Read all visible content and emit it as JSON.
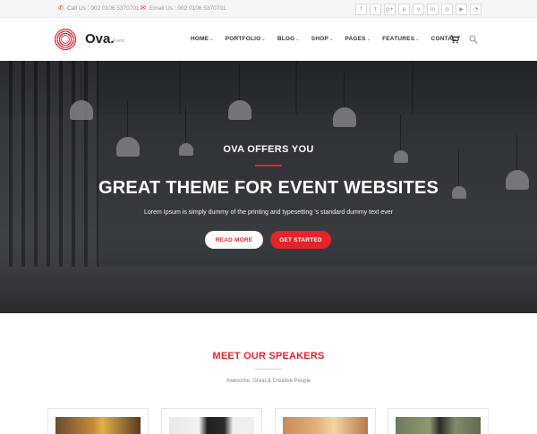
{
  "topbar": {
    "call": "Call Us : 002 0106 5370701",
    "email": "Email Us : 002 0106 5370701",
    "socials": [
      {
        "icon": "facebook-icon",
        "glyph": "f"
      },
      {
        "icon": "twitter-icon",
        "glyph": "t"
      },
      {
        "icon": "google-plus-icon",
        "glyph": "g+"
      },
      {
        "icon": "pinterest-icon",
        "glyph": "p"
      },
      {
        "icon": "vine-icon",
        "glyph": "v"
      },
      {
        "icon": "linkedin-icon",
        "glyph": "in"
      },
      {
        "icon": "dribbble-icon",
        "glyph": "◎"
      },
      {
        "icon": "youtube-icon",
        "glyph": "▶"
      },
      {
        "icon": "rss-icon",
        "glyph": "◔"
      }
    ]
  },
  "header": {
    "brand": "Ova.",
    "brand_sub": "Event",
    "nav": [
      {
        "label": "HOME",
        "dropdown": true
      },
      {
        "label": "PORTFOLIO",
        "dropdown": true
      },
      {
        "label": "BLOG",
        "dropdown": true
      },
      {
        "label": "SHOP",
        "dropdown": true
      },
      {
        "label": "PAGES",
        "dropdown": true
      },
      {
        "label": "FEATURES",
        "dropdown": true
      },
      {
        "label": "CONTACT",
        "dropdown": false
      }
    ]
  },
  "hero": {
    "kicker": "OVA OFFERS YOU",
    "headline": "GREAT THEME FOR EVENT WEBSITES",
    "subtext": "Lorem Ipsum is simply dummy of the printing and typesetting 's standard dummy text ever",
    "read_more": "READ MORE",
    "get_started": "GET STARTED"
  },
  "speakers": {
    "title": "MEET OUR SPEAKERS",
    "subtitle": "Awesome, Great & Creative People"
  },
  "colors": {
    "accent": "#e5232b"
  }
}
